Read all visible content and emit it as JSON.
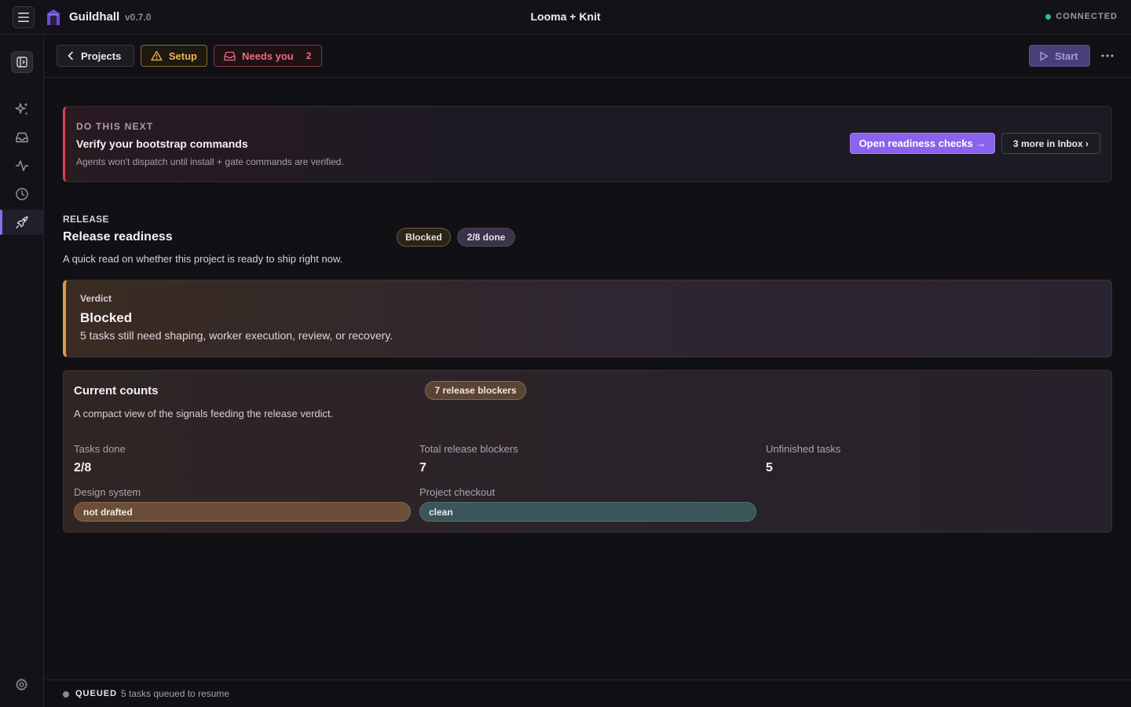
{
  "app": {
    "name": "Guildhall",
    "version": "v0.7.0",
    "window_title": "Looma + Knit",
    "connection_status": "CONNECTED",
    "connection_color": "#2fc48d"
  },
  "toolbar": {
    "projects_label": "Projects",
    "setup_label": "Setup",
    "needs_you_label": "Needs you",
    "needs_you_count": "2",
    "start_label": "Start"
  },
  "sidebar": {
    "items": [
      {
        "icon": "sparkle-icon"
      },
      {
        "icon": "inbox-icon"
      },
      {
        "icon": "activity-icon"
      },
      {
        "icon": "clock-icon"
      },
      {
        "icon": "rocket-icon",
        "active": true
      }
    ],
    "settings_icon": "gear-icon"
  },
  "next_action": {
    "kicker": "DO THIS NEXT",
    "title": "Verify your bootstrap commands",
    "description": "Agents won't dispatch until install + gate commands are verified.",
    "primary_button": "Open readiness checks →",
    "secondary_button": "3 more in Inbox ›"
  },
  "release": {
    "kicker": "RELEASE",
    "title": "Release readiness",
    "status_badge": "Blocked",
    "progress_badge": "2/8 done",
    "description": "A quick read on whether this project is ready to ship right now."
  },
  "verdict": {
    "kicker": "Verdict",
    "title": "Blocked",
    "description": "5 tasks still need shaping, worker execution, review, or recovery."
  },
  "counts": {
    "title": "Current counts",
    "badge": "7 release blockers",
    "description": "A compact view of the signals feeding the release verdict.",
    "stats": [
      {
        "label": "Tasks done",
        "value": "2/8"
      },
      {
        "label": "Total release blockers",
        "value": "7"
      },
      {
        "label": "Unfinished tasks",
        "value": "5"
      }
    ],
    "design_system": {
      "label": "Design system",
      "value": "not drafted"
    },
    "project_checkout": {
      "label": "Project checkout",
      "value": "clean"
    }
  },
  "statusbar": {
    "label": "QUEUED",
    "text": "5 tasks queued to resume"
  },
  "colors": {
    "accent": "#8a62ec",
    "danger": "#d7444e",
    "warning": "#dc9c3f"
  }
}
